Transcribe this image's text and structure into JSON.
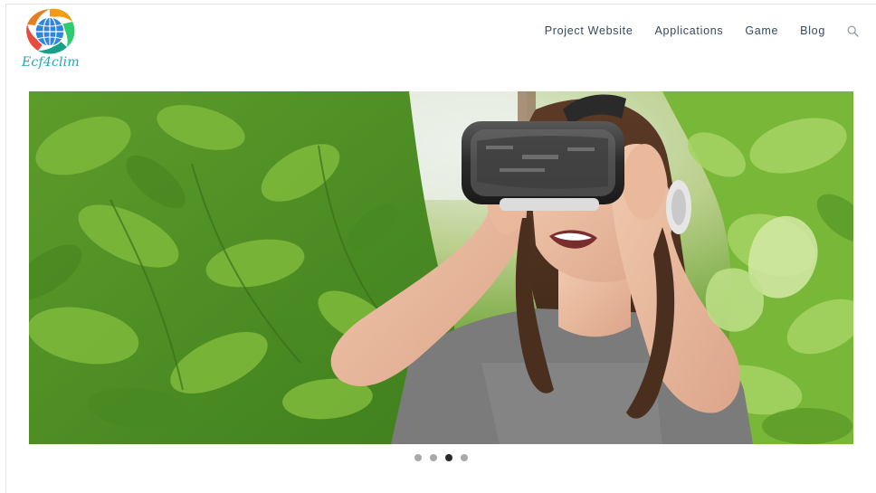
{
  "brand": {
    "logo_text": "Ecf4clim",
    "logo_icon": "globe-logo-icon"
  },
  "nav": {
    "items": [
      {
        "label": "Project Website"
      },
      {
        "label": "Applications"
      },
      {
        "label": "Game"
      },
      {
        "label": "Blog"
      }
    ],
    "search_icon": "search-icon"
  },
  "hero": {
    "image_alt": "Girl wearing VR headset among green plants",
    "slide_count": 4,
    "active_slide": 3
  },
  "colors": {
    "nav_text": "#34495e",
    "logo_teal": "#1da7b8",
    "dot_inactive": "#a9a9a9",
    "dot_active": "#2a2a2a"
  }
}
